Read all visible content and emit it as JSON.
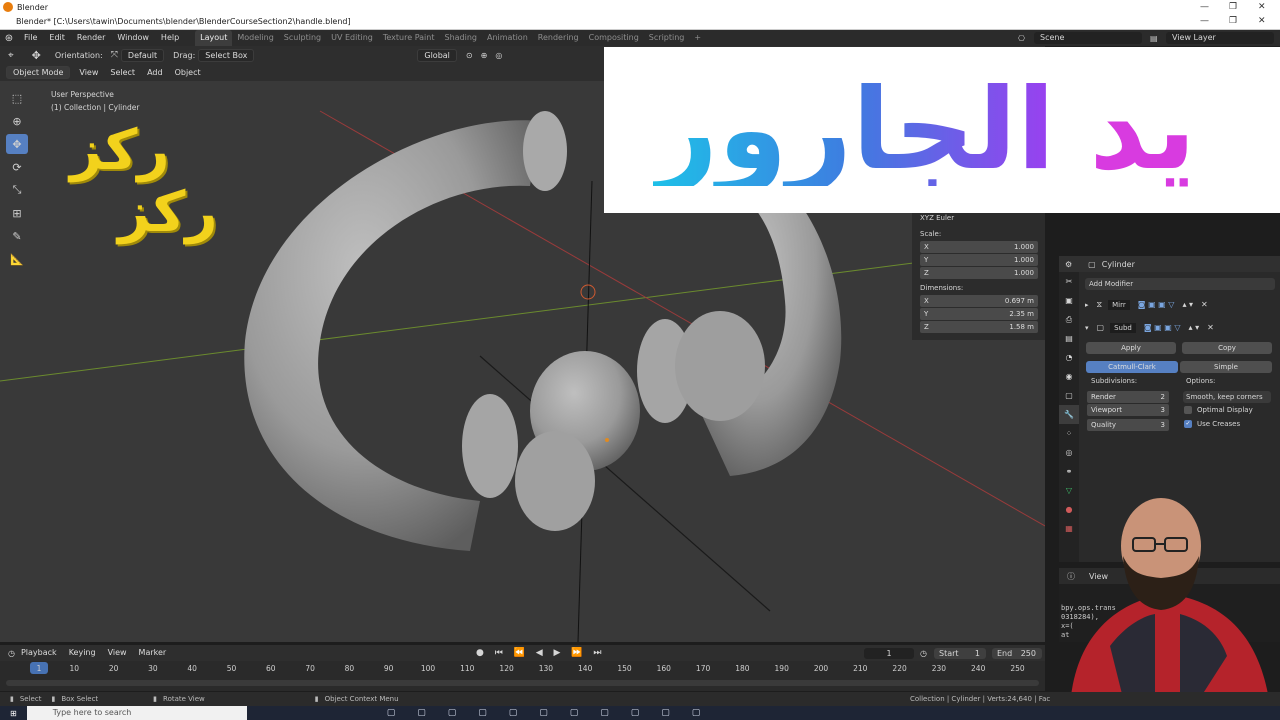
{
  "window": {
    "app_name": "Blender",
    "title": "Blender* [C:\\Users\\tawin\\Documents\\blender\\BlenderCourseSection2\\handle.blend]"
  },
  "menu": {
    "items": [
      "File",
      "Edit",
      "Render",
      "Window",
      "Help"
    ],
    "workspaces": [
      "Layout",
      "Modeling",
      "Sculpting",
      "UV Editing",
      "Texture Paint",
      "Shading",
      "Animation",
      "Rendering",
      "Compositing",
      "Scripting"
    ],
    "active_workspace": "Layout",
    "scene": "Scene",
    "view_layer": "View Layer"
  },
  "tool_header": {
    "orientation_label": "Orientation:",
    "orientation_value": "Default",
    "drag_label": "Drag:",
    "drag_value": "Select Box",
    "transform": "Global"
  },
  "viewport_header": {
    "mode": "Object Mode",
    "menus": [
      "View",
      "Select",
      "Add",
      "Object"
    ]
  },
  "viewport": {
    "perspective": "User Perspective",
    "collection": "(1) Collection | Cylinder"
  },
  "overlay": {
    "arabic_title": "يد الجارور",
    "yellow_line1": "ركز",
    "yellow_line2": "ركز"
  },
  "npanel": {
    "rotation_mode": "XYZ Euler",
    "scale_label": "Scale:",
    "scale": [
      {
        "axis": "X",
        "value": "1.000"
      },
      {
        "axis": "Y",
        "value": "1.000"
      },
      {
        "axis": "Z",
        "value": "1.000"
      }
    ],
    "dimensions_label": "Dimensions:",
    "dimensions": [
      {
        "axis": "X",
        "value": "0.697 m"
      },
      {
        "axis": "Y",
        "value": "2.35 m"
      },
      {
        "axis": "Z",
        "value": "1.58 m"
      }
    ]
  },
  "properties": {
    "object_name": "Cylinder",
    "add_modifier": "Add Modifier",
    "modifiers": [
      {
        "name": "Mirr"
      },
      {
        "name": "Subd"
      }
    ],
    "apply": "Apply",
    "copy": "Copy",
    "catmull": "Catmull-Clark",
    "simple": "Simple",
    "subdivisions_label": "Subdivisions:",
    "options_label": "Options:",
    "render_label": "Render",
    "render_value": "2",
    "viewport_label": "Viewport",
    "viewport_value": "3",
    "quality_label": "Quality",
    "quality_value": "3",
    "uv_smooth": "Smooth, keep corners",
    "optimal_display": "Optimal Display",
    "use_creases": "Use Creases"
  },
  "console": {
    "view_label": "View",
    "lines": [
      "bpy.ops.trans",
      "0318284),",
      "x=(",
      "at"
    ]
  },
  "timeline": {
    "menus": [
      "Playback",
      "Keying",
      "View",
      "Marker"
    ],
    "current_frame": "1",
    "start_label": "Start",
    "start": "1",
    "end_label": "End",
    "end": "250",
    "ticks": [
      "1",
      "10",
      "20",
      "30",
      "40",
      "50",
      "60",
      "70",
      "80",
      "90",
      "100",
      "110",
      "120",
      "130",
      "140",
      "150",
      "160",
      "170",
      "180",
      "190",
      "200",
      "210",
      "220",
      "230",
      "240",
      "250"
    ]
  },
  "status": {
    "select": "Select",
    "box_select": "Box Select",
    "rotate_view": "Rotate View",
    "context_menu": "Object Context Menu",
    "stats": "Collection | Cylinder | Verts:24,640 | Fac"
  },
  "taskbar": {
    "search_placeholder": "Type here to search"
  },
  "colors": {
    "accent": "#5680c2",
    "viewport_bg": "#393939",
    "yellow_text": "#f2d21c",
    "title_gradient": [
      "#1ec0e8",
      "#3f7be0",
      "#9c3ff0",
      "#d83be0"
    ]
  }
}
